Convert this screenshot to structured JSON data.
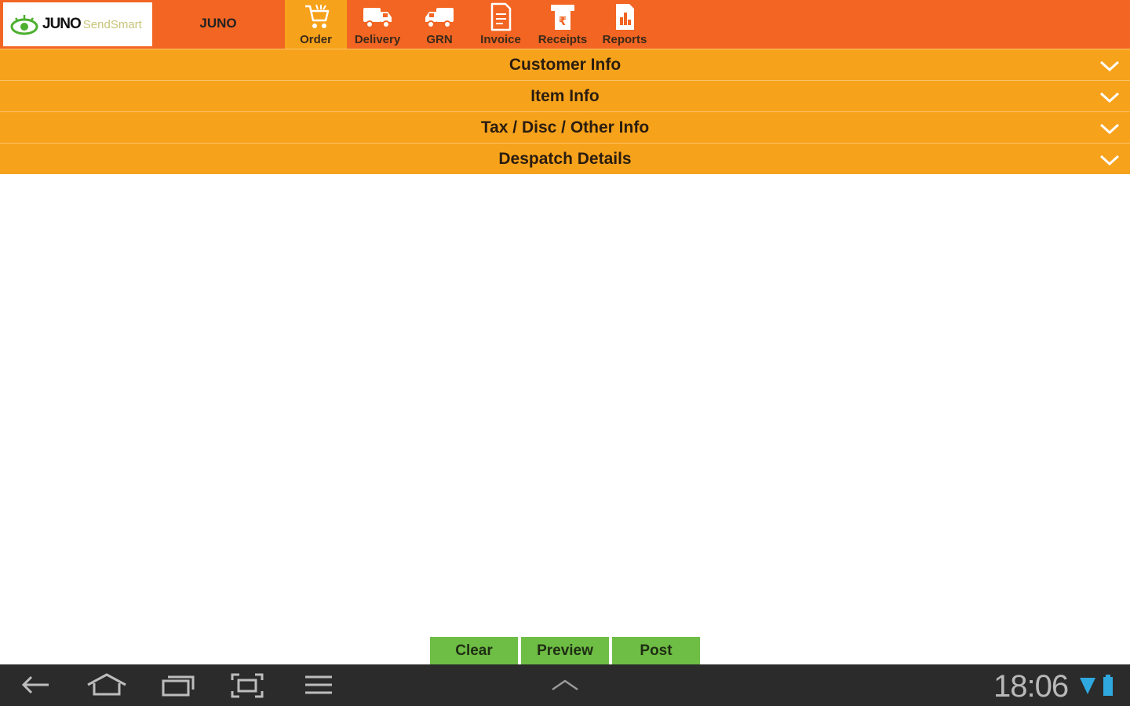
{
  "app": {
    "logo_main": "JUNO",
    "logo_sub": "SendSmart",
    "company": "JUNO"
  },
  "nav": [
    {
      "label": "Order",
      "icon": "cart-icon",
      "active": true
    },
    {
      "label": "Delivery",
      "icon": "truck-icon",
      "active": false
    },
    {
      "label": "GRN",
      "icon": "grn-truck-icon",
      "active": false
    },
    {
      "label": "Invoice",
      "icon": "document-icon",
      "active": false
    },
    {
      "label": "Receipts",
      "icon": "receipt-icon",
      "active": false
    },
    {
      "label": "Reports",
      "icon": "report-icon",
      "active": false
    }
  ],
  "sections": [
    {
      "title": "Customer Info"
    },
    {
      "title": "Item Info"
    },
    {
      "title": "Tax / Disc / Other Info"
    },
    {
      "title": "Despatch Details"
    }
  ],
  "actions": {
    "clear": "Clear",
    "preview": "Preview",
    "post": "Post"
  },
  "system": {
    "time": "18:06"
  },
  "colors": {
    "topbar": "#f26522",
    "accent": "#f7a21b",
    "button": "#6ebd44",
    "system_bar": "#2b2b2b"
  }
}
